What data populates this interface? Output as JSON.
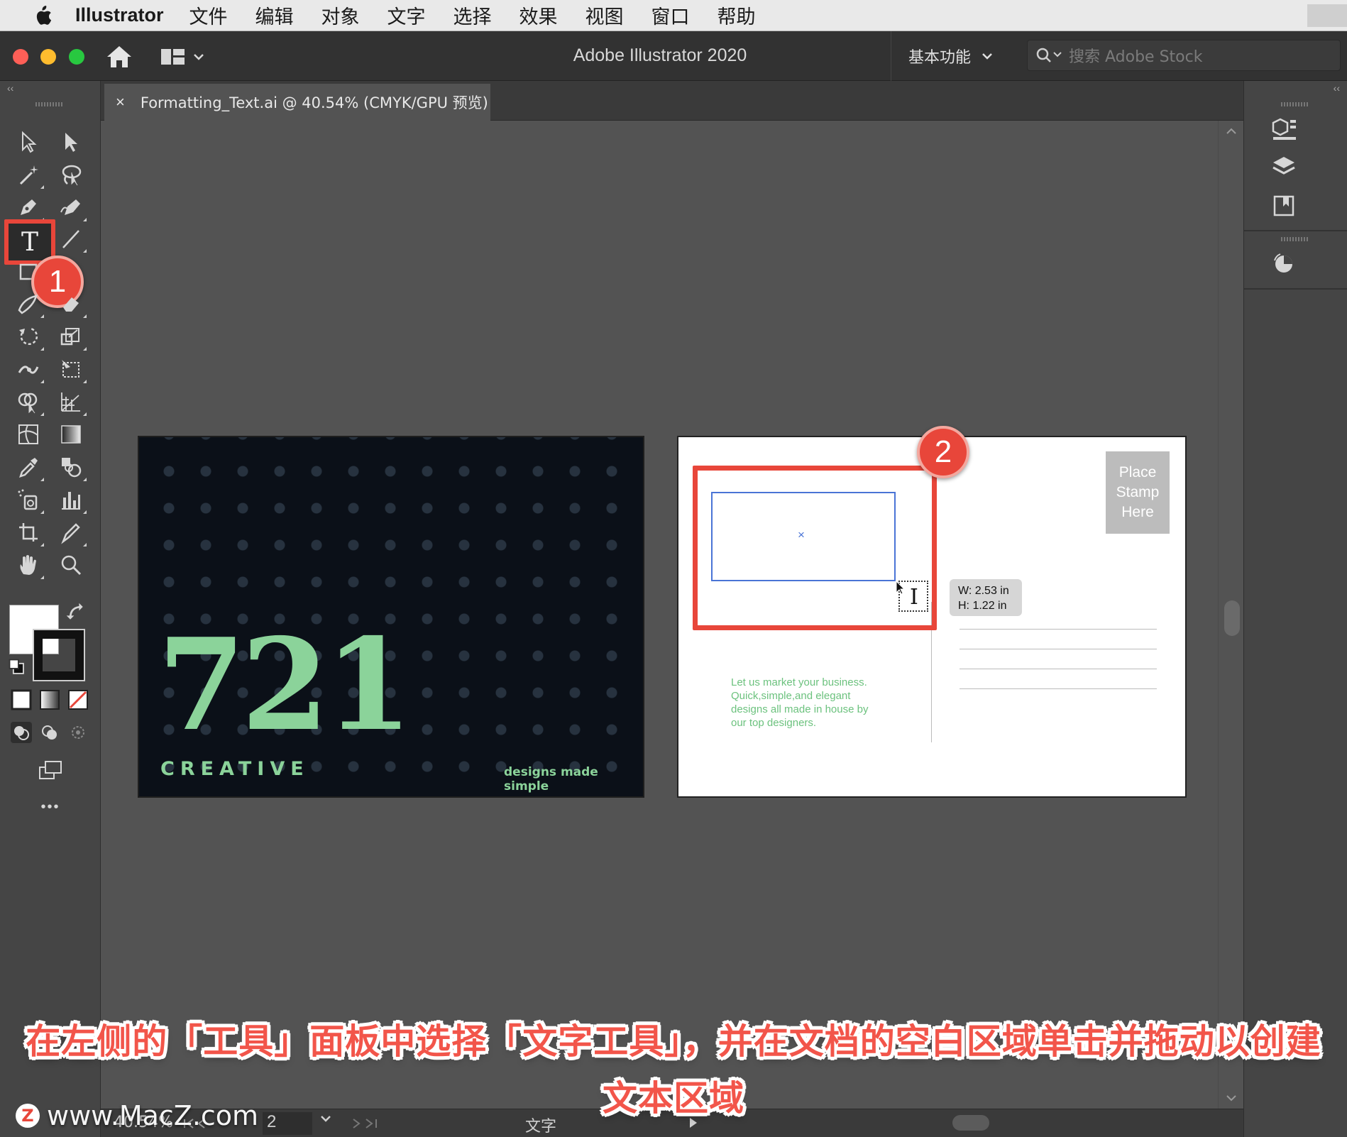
{
  "menubar": {
    "app_name": "Illustrator",
    "items": [
      "文件",
      "编辑",
      "对象",
      "文字",
      "选择",
      "效果",
      "视图",
      "窗口",
      "帮助"
    ]
  },
  "titlebar": {
    "window_title": "Adobe Illustrator 2020",
    "workspace_label": "基本功能",
    "search_placeholder": "搜索 Adobe Stock"
  },
  "document_tab": {
    "close_glyph": "×",
    "title": "Formatting_Text.ai @ 40.54% (CMYK/GPU 预览)"
  },
  "toolbar": {
    "type_tool_glyph": "T",
    "step1_badge": "1",
    "more_glyph": "•••"
  },
  "artboard_front": {
    "number": "721",
    "brand": "CREATIVE",
    "tagline": "designs made simple",
    "accent_color": "#8bd39a",
    "background_color": "#0b1018"
  },
  "artboard_back": {
    "stamp_lines": [
      "Place",
      "Stamp",
      "Here"
    ],
    "body_lines": [
      "Let us market your business.",
      "Quick,simple,and elegant",
      "designs all made in house by",
      "our top designers."
    ],
    "step2_badge": "2",
    "frame_center_mark": "×",
    "tooltip_w": "W: 2.53 in",
    "tooltip_h": "H: 1.22 in"
  },
  "statusbar": {
    "zoom": "40.54%",
    "page": "2",
    "current_tool": "文字"
  },
  "caption": {
    "line1": "在左侧的「工具」面板中选择「文字工具」，并在文档的空白区域单击并拖动以创建",
    "line2": "文本区域"
  },
  "watermark": {
    "logo_letter": "Z",
    "text": "www.MacZ.com"
  },
  "colors": {
    "highlight": "#e8463a",
    "selection_frame": "#4a74d6"
  }
}
